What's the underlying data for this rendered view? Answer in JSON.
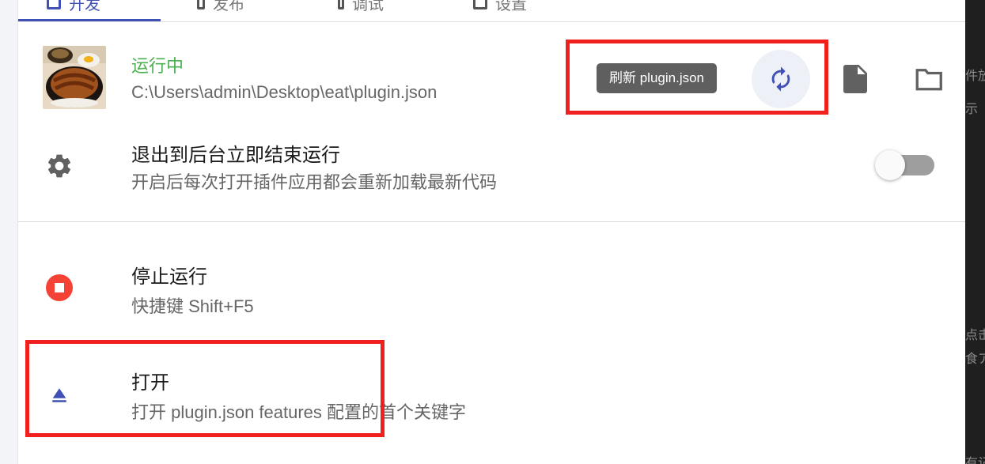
{
  "tabs": [
    {
      "label": "开发",
      "active": true
    },
    {
      "label": "发布",
      "active": false
    },
    {
      "label": "调试",
      "active": false
    },
    {
      "label": "设置",
      "active": false
    }
  ],
  "plugin": {
    "status": "运行中",
    "path": "C:\\Users\\admin\\Desktop\\eat\\plugin.json",
    "thumbnail": "eel-rice-bowl-image",
    "refresh_tooltip": "刷新 plugin.json",
    "icons": [
      "refresh-icon",
      "file-icon",
      "folder-icon"
    ]
  },
  "setting": {
    "title": "退出到后台立即结束运行",
    "description": "开启后每次打开插件应用都会重新加载最新代码",
    "enabled": false,
    "icon": "gear-icon"
  },
  "stop": {
    "title": "停止运行",
    "shortcut": "快捷键 Shift+F5",
    "icon": "stop-icon"
  },
  "open": {
    "title": "打开",
    "description": "打开 plugin.json features 配置的首个关键字",
    "icon": "eject-icon"
  },
  "right_edge": [
    "件放",
    "示",
    "点击",
    "食ア",
    "有记"
  ],
  "colors": {
    "accent": "#3f51b5",
    "running": "#4caf50",
    "stop": "#f44336",
    "highlight": "#f0201e",
    "tooltip_bg": "#5f5f5f"
  }
}
